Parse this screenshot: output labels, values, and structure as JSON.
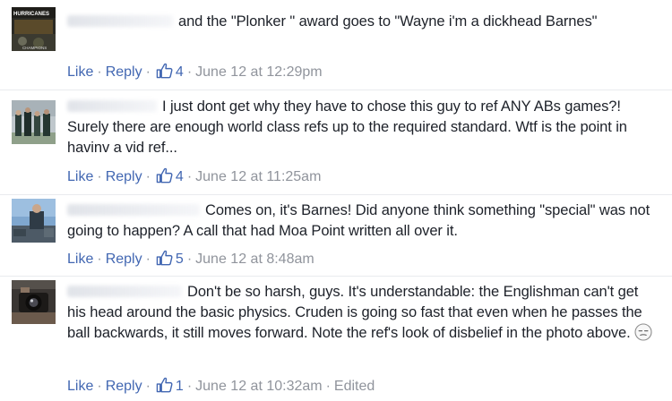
{
  "comments": [
    {
      "text": "and the \"Plonker \" award goes to \"Wayne i'm a dickhead Barnes\"",
      "like_label": "Like",
      "reply_label": "Reply",
      "like_count": "4",
      "timestamp": "June 12 at 12:29pm",
      "edited": "",
      "avatar_label": "HURRICANES",
      "avatar_sub": "CHAMPIONS"
    },
    {
      "text": "I just dont get why they have to chose this guy to ref ANY ABs games?! Surely there are enough world class refs up to the required standard. Wtf is the point in havinv a vid ref...",
      "like_label": "Like",
      "reply_label": "Reply",
      "like_count": "4",
      "timestamp": "June 12 at 11:25am",
      "edited": ""
    },
    {
      "text": "Comes on, it's Barnes! Did anyone think something \"special\" was not going to happen? A call that had Moa Point written all over it.",
      "like_label": "Like",
      "reply_label": "Reply",
      "like_count": "5",
      "timestamp": "June 12 at 8:48am",
      "edited": ""
    },
    {
      "text": "Don't be so harsh, guys. It's understandable: the Englishman can't get his head around the basic physics. Cruden is going so fast that even when he passes the ball backwards, it still moves forward. Note the ref's look of disbelief in the photo above.",
      "like_label": "Like",
      "reply_label": "Reply",
      "like_count": "1",
      "timestamp": "June 12 at 10:32am",
      "edited": "Edited"
    }
  ],
  "colors": {
    "link": "#4267b2",
    "meta": "#90949c",
    "text": "#1d2129",
    "divider": "#e9ebee"
  },
  "icons": {
    "like": "thumbs-up-icon",
    "emoji": "unamused-face-emoji"
  }
}
